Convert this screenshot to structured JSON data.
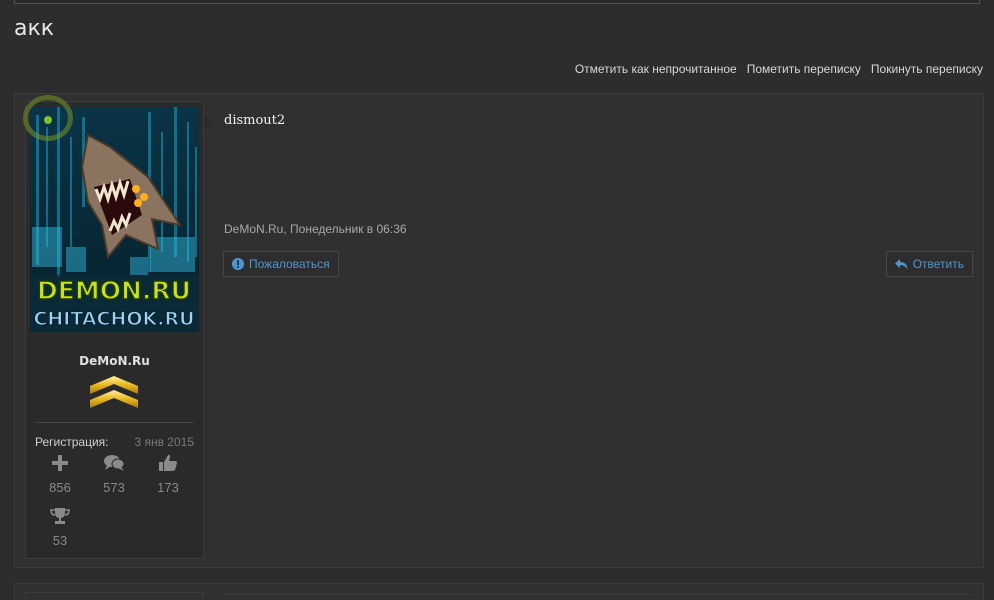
{
  "page": {
    "title": "акк"
  },
  "actions": {
    "mark_unread": "Отметить как непрочитанное",
    "star": "Пометить переписку",
    "leave": "Покинуть переписку"
  },
  "message": {
    "author": "dismout2",
    "meta": "DeMoN.Ru, Понедельник в 06:36",
    "report_label": "Пожаловаться",
    "reply_label": "Ответить"
  },
  "user": {
    "avatar_text_top": "DEMON.RU",
    "avatar_text_bottom": "CHITACHOK.RU",
    "name": "DeMoN.Ru",
    "registration_label": "Регистрация:",
    "registration_date": "3 янв 2015",
    "stats": [
      {
        "icon": "plus-icon",
        "value": "856"
      },
      {
        "icon": "comments-icon",
        "value": "573"
      },
      {
        "icon": "thumbs-up-icon",
        "value": "173"
      },
      {
        "icon": "trophy-icon",
        "value": "53"
      }
    ]
  },
  "colors": {
    "background": "#2d2d2d",
    "link": "#4f96d0",
    "online": "#7fc02b",
    "rank_gold": "#e8b820"
  }
}
